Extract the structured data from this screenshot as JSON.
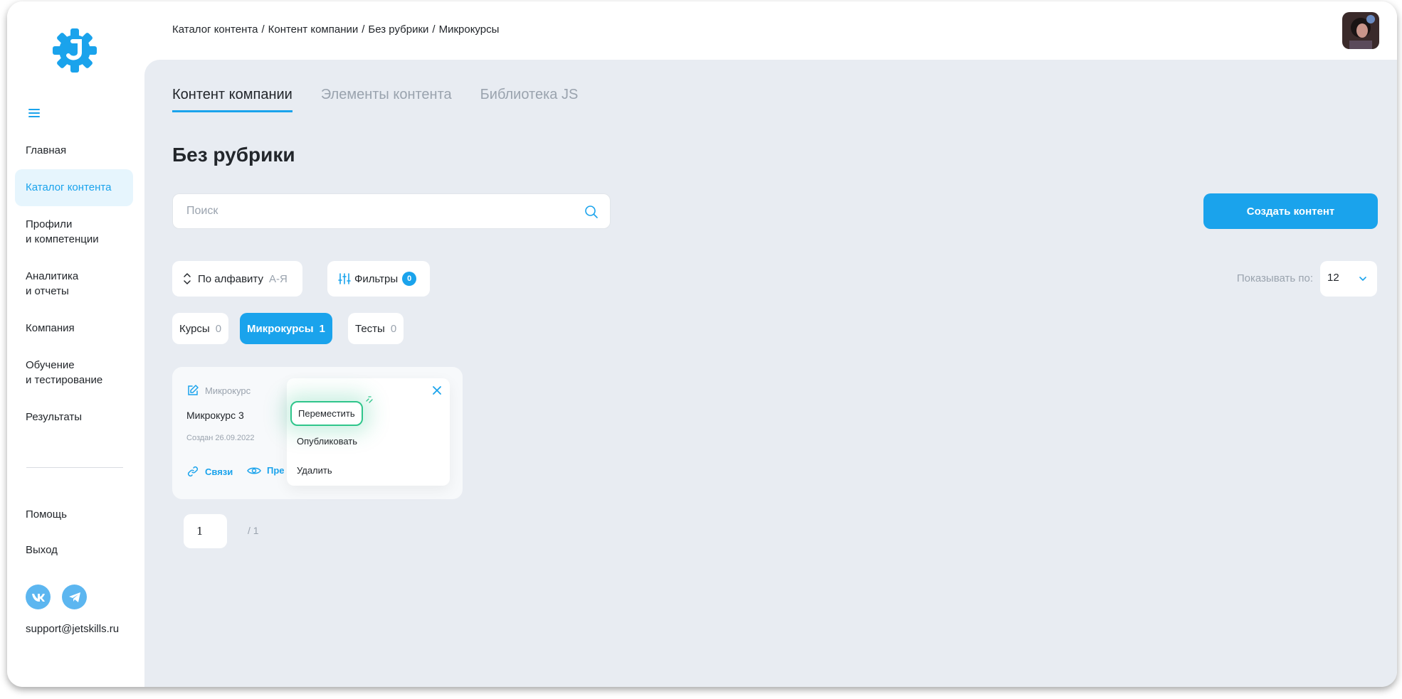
{
  "breadcrumb": [
    "Каталог контента",
    "Контент компании",
    "Без рубрики",
    "Микрокурсы"
  ],
  "sidebar": {
    "items": [
      {
        "label": "Главная"
      },
      {
        "label": "Каталог контента"
      },
      {
        "line1": "Профили",
        "line2": "и компетенции"
      },
      {
        "line1": "Аналитика",
        "line2": "и отчеты"
      },
      {
        "label": "Компания"
      },
      {
        "line1": "Обучение",
        "line2": "и тестирование"
      },
      {
        "label": "Результаты"
      }
    ],
    "help": "Помощь",
    "logout": "Выход",
    "support_email": "support@jetskills.ru"
  },
  "tabs": [
    "Контент компании",
    "Элементы контента",
    "Библиотека JS"
  ],
  "page_title": "Без рубрики",
  "search": {
    "placeholder": "Поиск"
  },
  "create_button": "Создать контент",
  "sort": {
    "label": "По алфавиту",
    "order": "А-Я"
  },
  "filters": {
    "label": "Фильтры",
    "count": "0"
  },
  "per_page": {
    "label": "Показывать по:",
    "value": "12"
  },
  "types": [
    {
      "label": "Курсы",
      "count": "0"
    },
    {
      "label": "Микрокурсы",
      "count": "1"
    },
    {
      "label": "Тесты",
      "count": "0"
    }
  ],
  "card": {
    "type": "Микрокурс",
    "title": "Микрокурс 3",
    "date": "Создан 26.09.2022",
    "links_label": "Связи",
    "preview_label": "Пре"
  },
  "menu": {
    "move": "Переместить",
    "publish": "Опубликовать",
    "delete": "Удалить"
  },
  "pagination": {
    "current": "1",
    "total": "/ 1"
  },
  "colors": {
    "accent": "#1aa3ec",
    "highlight": "#2fc58b",
    "background": "#e8ecf2"
  }
}
